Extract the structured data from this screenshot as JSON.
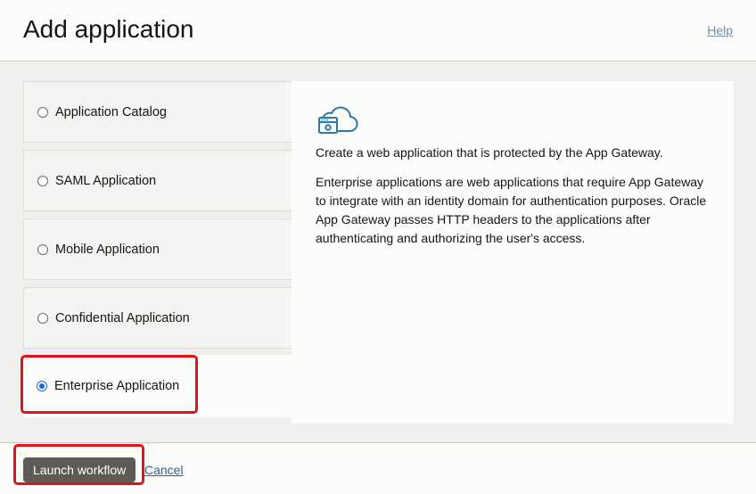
{
  "header": {
    "title": "Add application",
    "help_label": "Help"
  },
  "options": [
    {
      "label": "Application Catalog",
      "selected": false
    },
    {
      "label": "SAML Application",
      "selected": false
    },
    {
      "label": "Mobile Application",
      "selected": false
    },
    {
      "label": "Confidential Application",
      "selected": false
    },
    {
      "label": "Enterprise Application",
      "selected": true
    }
  ],
  "detail": {
    "icon": "cloud-app-gateway-icon",
    "summary": "Create a web application that is protected by the App Gateway.",
    "description": "Enterprise applications are web applications that require App Gateway to integrate with an identity domain for authentication purposes. Oracle App Gateway passes HTTP headers to the applications after authenticating and authorizing the user's access."
  },
  "footer": {
    "launch_label": "Launch workflow",
    "cancel_label": "Cancel"
  },
  "colors": {
    "accent": "#1f66d6",
    "highlight": "#e0141b",
    "icon": "#2a7aa8",
    "primary_button": "#5e5b57"
  }
}
